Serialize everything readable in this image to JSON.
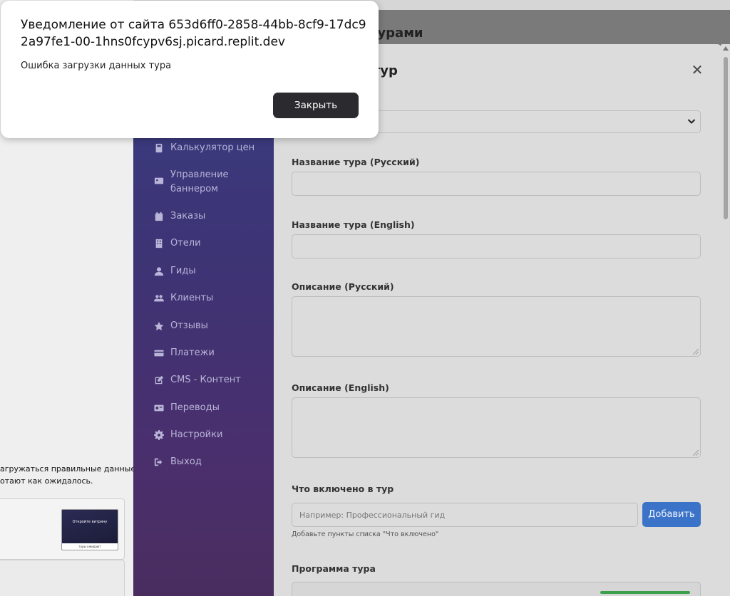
{
  "alert": {
    "title": "Уведомление от сайта 653d6ff0-2858-44bb-8cf9-17dc92a97fe1-00-1hns0fcypv6sj.picard.replit.dev",
    "message": "Ошибка загрузки данных тура",
    "close_button": "Закрыть"
  },
  "page": {
    "header_title_visible": "турами"
  },
  "left_panel": {
    "line1": "агружаться правильные данные",
    "line2": "отают как ожидалось.",
    "thumb_text_top": "Откройте витрину",
    "thumb_text_bottom": "туры ожидают"
  },
  "sidebar": {
    "items": [
      {
        "label": "Калькулятор цен",
        "icon": "calculator-icon"
      },
      {
        "label": "Управление баннером",
        "icon": "image-icon"
      },
      {
        "label": "Заказы",
        "icon": "calendar-check-icon"
      },
      {
        "label": "Отели",
        "icon": "building-icon"
      },
      {
        "label": "Гиды",
        "icon": "user-icon"
      },
      {
        "label": "Клиенты",
        "icon": "users-icon"
      },
      {
        "label": "Отзывы",
        "icon": "star-icon"
      },
      {
        "label": "Платежи",
        "icon": "credit-card-icon"
      },
      {
        "label": "CMS - Контент",
        "icon": "edit-icon"
      },
      {
        "label": "Переводы",
        "icon": "language-icon"
      },
      {
        "label": "Настройки",
        "icon": "gear-icon"
      },
      {
        "label": "Выход",
        "icon": "sign-out-icon"
      }
    ]
  },
  "modal": {
    "title_visible": "дактировать тур",
    "fields": {
      "name_ru": "Название тура (Русский)",
      "name_en": "Название тура (English)",
      "desc_ru": "Описание (Русский)",
      "desc_en": "Описание (English)",
      "included": "Что включено в тур",
      "program": "Программа тура"
    },
    "included_placeholder": "Например: Профессиональный гид",
    "add_button": "Добавить",
    "included_hint": "Добавьте пункты списка \"Что включено\""
  },
  "colors": {
    "sidebar_top": "#3a3f85",
    "sidebar_bottom": "#4a2d5f",
    "add_button": "#3b73c8",
    "alert_button": "#2b2b2f"
  }
}
